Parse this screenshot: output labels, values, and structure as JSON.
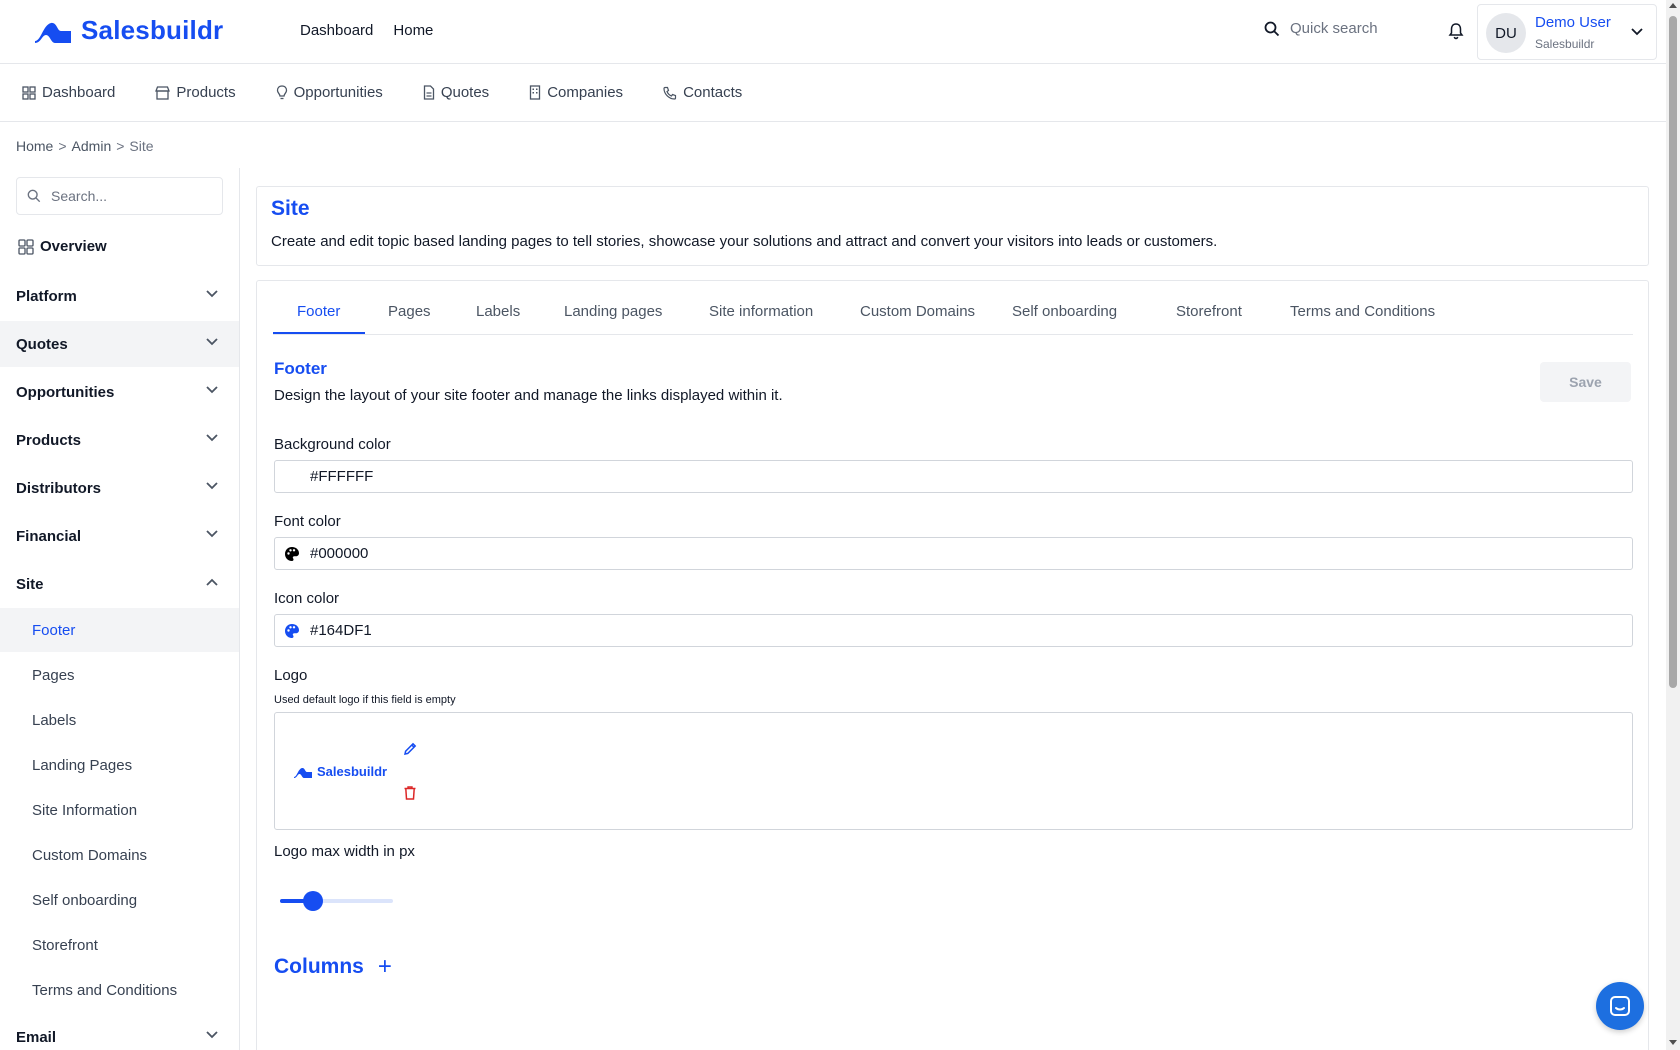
{
  "brand": {
    "name": "Salesbuildr",
    "accent": "#164DF1"
  },
  "topnav": [
    {
      "label": "Dashboard"
    },
    {
      "label": "Home"
    }
  ],
  "quick_search": {
    "placeholder": "Quick search",
    "icon": "search-icon"
  },
  "user": {
    "initials": "DU",
    "name": "Demo User",
    "org": "Salesbuildr"
  },
  "subnav": [
    {
      "label": "Dashboard",
      "icon": "grid-icon"
    },
    {
      "label": "Products",
      "icon": "store-icon"
    },
    {
      "label": "Opportunities",
      "icon": "lightbulb-icon"
    },
    {
      "label": "Quotes",
      "icon": "document-icon"
    },
    {
      "label": "Companies",
      "icon": "building-icon"
    },
    {
      "label": "Contacts",
      "icon": "phone-icon"
    }
  ],
  "breadcrumb": {
    "items": [
      "Home",
      "Admin",
      "Site"
    ],
    "separator": ">"
  },
  "sidebar": {
    "search_placeholder": "Search...",
    "overview": "Overview",
    "groups": [
      {
        "label": "Platform"
      },
      {
        "label": "Quotes"
      },
      {
        "label": "Opportunities"
      },
      {
        "label": "Products"
      },
      {
        "label": "Distributors"
      },
      {
        "label": "Financial"
      },
      {
        "label": "Site"
      }
    ],
    "site_items": [
      {
        "label": "Footer"
      },
      {
        "label": "Pages"
      },
      {
        "label": "Labels"
      },
      {
        "label": "Landing Pages"
      },
      {
        "label": "Site Information"
      },
      {
        "label": "Custom Domains"
      },
      {
        "label": "Self onboarding"
      },
      {
        "label": "Storefront"
      },
      {
        "label": "Terms and Conditions"
      }
    ],
    "email_group": "Email"
  },
  "page": {
    "title": "Site",
    "description": "Create and edit topic based landing pages to tell stories, showcase your solutions and attract and convert your visitors into leads or customers."
  },
  "tabs": [
    {
      "label": "Footer"
    },
    {
      "label": "Pages"
    },
    {
      "label": "Labels"
    },
    {
      "label": "Landing pages"
    },
    {
      "label": "Site information"
    },
    {
      "label": "Custom Domains"
    },
    {
      "label": "Self onboarding"
    },
    {
      "label": "Storefront"
    },
    {
      "label": "Terms and Conditions"
    }
  ],
  "footer_form": {
    "title": "Footer",
    "description": "Design the layout of your site footer and manage the links displayed within it.",
    "save_label": "Save",
    "background_color": {
      "label": "Background color",
      "value": "#FFFFFF"
    },
    "font_color": {
      "label": "Font color",
      "value": "#000000"
    },
    "icon_color": {
      "label": "Icon color",
      "value": "#164DF1"
    },
    "logo": {
      "label": "Logo",
      "hint": "Used default logo if this field is empty",
      "preview_text": "Salesbuildr"
    },
    "logo_max_width": {
      "label": "Logo max width in px",
      "fraction": 0.22
    },
    "columns_title": "Columns",
    "columns_add": "+"
  }
}
